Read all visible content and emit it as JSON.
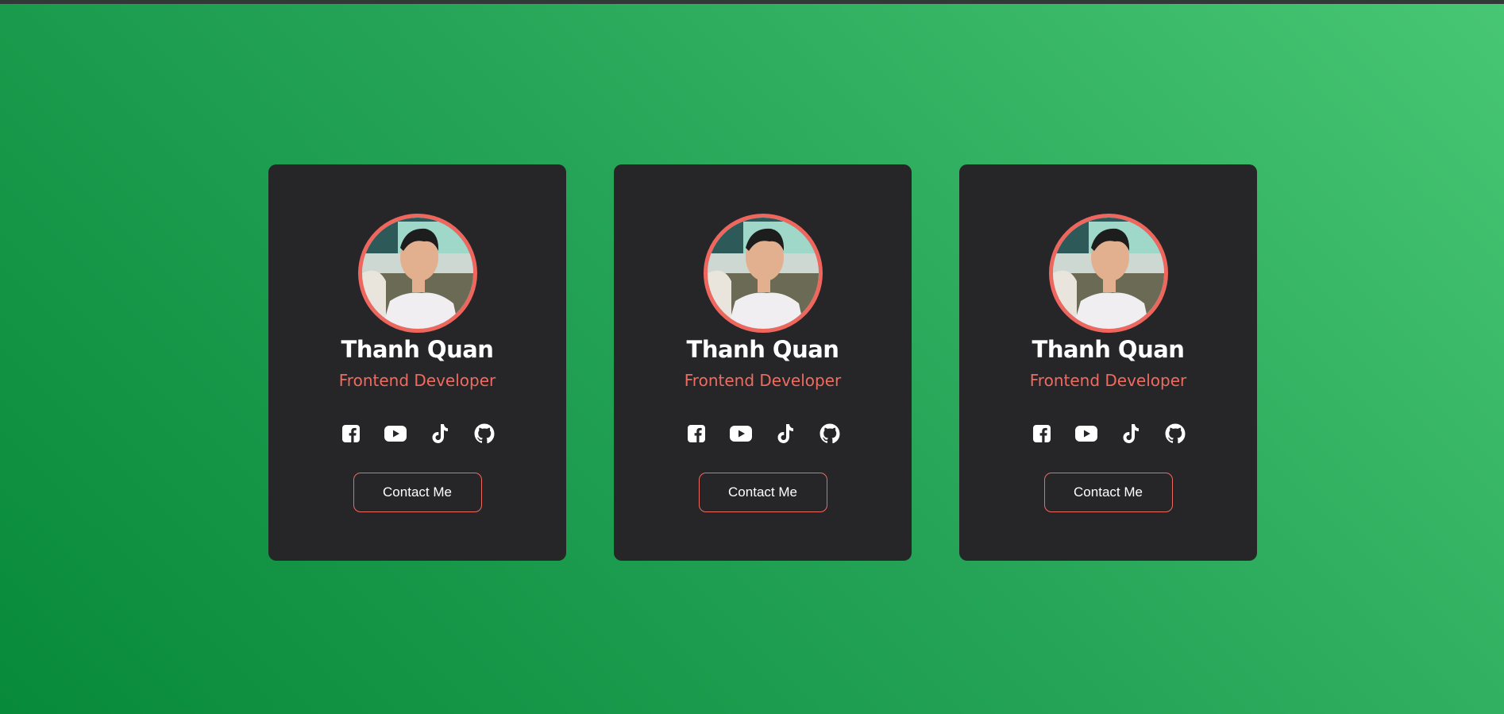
{
  "colors": {
    "background_gradient_start": "#078a39",
    "background_gradient_end": "#47c673",
    "card_background": "#262628",
    "accent": "#ee665d",
    "text_primary": "#ffffff"
  },
  "cards": [
    {
      "name": "Thanh Quan",
      "role": "Frontend Developer",
      "socials": [
        {
          "icon": "facebook-icon"
        },
        {
          "icon": "youtube-icon"
        },
        {
          "icon": "tiktok-icon"
        },
        {
          "icon": "github-icon"
        }
      ],
      "button_label": "Contact Me"
    },
    {
      "name": "Thanh Quan",
      "role": "Frontend Developer",
      "socials": [
        {
          "icon": "facebook-icon"
        },
        {
          "icon": "youtube-icon"
        },
        {
          "icon": "tiktok-icon"
        },
        {
          "icon": "github-icon"
        }
      ],
      "button_label": "Contact Me"
    },
    {
      "name": "Thanh Quan",
      "role": "Frontend Developer",
      "socials": [
        {
          "icon": "facebook-icon"
        },
        {
          "icon": "youtube-icon"
        },
        {
          "icon": "tiktok-icon"
        },
        {
          "icon": "github-icon"
        }
      ],
      "button_label": "Contact Me"
    }
  ]
}
